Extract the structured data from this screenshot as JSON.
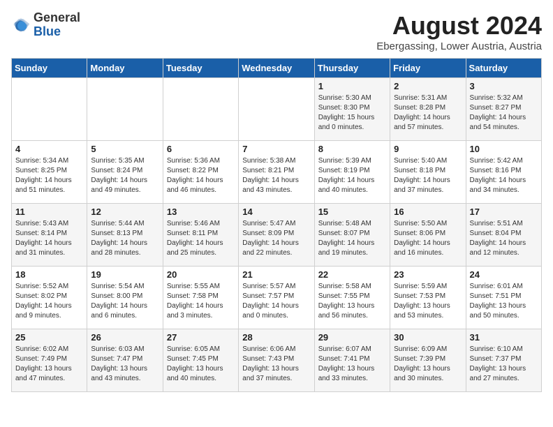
{
  "header": {
    "logo_general": "General",
    "logo_blue": "Blue",
    "title": "August 2024",
    "location": "Ebergassing, Lower Austria, Austria"
  },
  "weekdays": [
    "Sunday",
    "Monday",
    "Tuesday",
    "Wednesday",
    "Thursday",
    "Friday",
    "Saturday"
  ],
  "weeks": [
    [
      {
        "day": "",
        "info": ""
      },
      {
        "day": "",
        "info": ""
      },
      {
        "day": "",
        "info": ""
      },
      {
        "day": "",
        "info": ""
      },
      {
        "day": "1",
        "info": "Sunrise: 5:30 AM\nSunset: 8:30 PM\nDaylight: 15 hours\nand 0 minutes."
      },
      {
        "day": "2",
        "info": "Sunrise: 5:31 AM\nSunset: 8:28 PM\nDaylight: 14 hours\nand 57 minutes."
      },
      {
        "day": "3",
        "info": "Sunrise: 5:32 AM\nSunset: 8:27 PM\nDaylight: 14 hours\nand 54 minutes."
      }
    ],
    [
      {
        "day": "4",
        "info": "Sunrise: 5:34 AM\nSunset: 8:25 PM\nDaylight: 14 hours\nand 51 minutes."
      },
      {
        "day": "5",
        "info": "Sunrise: 5:35 AM\nSunset: 8:24 PM\nDaylight: 14 hours\nand 49 minutes."
      },
      {
        "day": "6",
        "info": "Sunrise: 5:36 AM\nSunset: 8:22 PM\nDaylight: 14 hours\nand 46 minutes."
      },
      {
        "day": "7",
        "info": "Sunrise: 5:38 AM\nSunset: 8:21 PM\nDaylight: 14 hours\nand 43 minutes."
      },
      {
        "day": "8",
        "info": "Sunrise: 5:39 AM\nSunset: 8:19 PM\nDaylight: 14 hours\nand 40 minutes."
      },
      {
        "day": "9",
        "info": "Sunrise: 5:40 AM\nSunset: 8:18 PM\nDaylight: 14 hours\nand 37 minutes."
      },
      {
        "day": "10",
        "info": "Sunrise: 5:42 AM\nSunset: 8:16 PM\nDaylight: 14 hours\nand 34 minutes."
      }
    ],
    [
      {
        "day": "11",
        "info": "Sunrise: 5:43 AM\nSunset: 8:14 PM\nDaylight: 14 hours\nand 31 minutes."
      },
      {
        "day": "12",
        "info": "Sunrise: 5:44 AM\nSunset: 8:13 PM\nDaylight: 14 hours\nand 28 minutes."
      },
      {
        "day": "13",
        "info": "Sunrise: 5:46 AM\nSunset: 8:11 PM\nDaylight: 14 hours\nand 25 minutes."
      },
      {
        "day": "14",
        "info": "Sunrise: 5:47 AM\nSunset: 8:09 PM\nDaylight: 14 hours\nand 22 minutes."
      },
      {
        "day": "15",
        "info": "Sunrise: 5:48 AM\nSunset: 8:07 PM\nDaylight: 14 hours\nand 19 minutes."
      },
      {
        "day": "16",
        "info": "Sunrise: 5:50 AM\nSunset: 8:06 PM\nDaylight: 14 hours\nand 16 minutes."
      },
      {
        "day": "17",
        "info": "Sunrise: 5:51 AM\nSunset: 8:04 PM\nDaylight: 14 hours\nand 12 minutes."
      }
    ],
    [
      {
        "day": "18",
        "info": "Sunrise: 5:52 AM\nSunset: 8:02 PM\nDaylight: 14 hours\nand 9 minutes."
      },
      {
        "day": "19",
        "info": "Sunrise: 5:54 AM\nSunset: 8:00 PM\nDaylight: 14 hours\nand 6 minutes."
      },
      {
        "day": "20",
        "info": "Sunrise: 5:55 AM\nSunset: 7:58 PM\nDaylight: 14 hours\nand 3 minutes."
      },
      {
        "day": "21",
        "info": "Sunrise: 5:57 AM\nSunset: 7:57 PM\nDaylight: 14 hours\nand 0 minutes."
      },
      {
        "day": "22",
        "info": "Sunrise: 5:58 AM\nSunset: 7:55 PM\nDaylight: 13 hours\nand 56 minutes."
      },
      {
        "day": "23",
        "info": "Sunrise: 5:59 AM\nSunset: 7:53 PM\nDaylight: 13 hours\nand 53 minutes."
      },
      {
        "day": "24",
        "info": "Sunrise: 6:01 AM\nSunset: 7:51 PM\nDaylight: 13 hours\nand 50 minutes."
      }
    ],
    [
      {
        "day": "25",
        "info": "Sunrise: 6:02 AM\nSunset: 7:49 PM\nDaylight: 13 hours\nand 47 minutes."
      },
      {
        "day": "26",
        "info": "Sunrise: 6:03 AM\nSunset: 7:47 PM\nDaylight: 13 hours\nand 43 minutes."
      },
      {
        "day": "27",
        "info": "Sunrise: 6:05 AM\nSunset: 7:45 PM\nDaylight: 13 hours\nand 40 minutes."
      },
      {
        "day": "28",
        "info": "Sunrise: 6:06 AM\nSunset: 7:43 PM\nDaylight: 13 hours\nand 37 minutes."
      },
      {
        "day": "29",
        "info": "Sunrise: 6:07 AM\nSunset: 7:41 PM\nDaylight: 13 hours\nand 33 minutes."
      },
      {
        "day": "30",
        "info": "Sunrise: 6:09 AM\nSunset: 7:39 PM\nDaylight: 13 hours\nand 30 minutes."
      },
      {
        "day": "31",
        "info": "Sunrise: 6:10 AM\nSunset: 7:37 PM\nDaylight: 13 hours\nand 27 minutes."
      }
    ]
  ]
}
